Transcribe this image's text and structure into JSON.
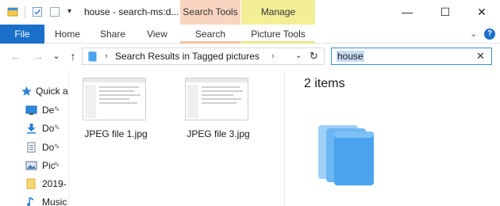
{
  "window": {
    "title": "house - search-ms:d...",
    "qat_dropdown_glyph": "▾",
    "controls": {
      "minimize": "—",
      "maximize": "☐",
      "close": "✕"
    }
  },
  "context_headers": {
    "search_tools": "Search Tools",
    "manage": "Manage"
  },
  "ribbon": {
    "tabs": [
      "File",
      "Home",
      "Share",
      "View",
      "Search",
      "Picture Tools"
    ],
    "collapse_glyph": "⌄",
    "help_glyph": "?"
  },
  "address": {
    "path_text": "Search Results in Tagged pictures",
    "crumb_sep": "›",
    "dropdown_glyph": "⌄",
    "refresh_glyph": "↻",
    "nav": {
      "back": "←",
      "forward": "→",
      "recent": "⌄",
      "up": "↑"
    }
  },
  "search": {
    "value": "house",
    "clear_glyph": "✕"
  },
  "nav_pane": {
    "items": [
      {
        "label": "Quick a",
        "icon": "star-icon",
        "pinned": false
      },
      {
        "label": "De",
        "icon": "desktop-icon",
        "pinned": true
      },
      {
        "label": "Do",
        "icon": "downloads-icon",
        "pinned": true
      },
      {
        "label": "Do",
        "icon": "documents-icon",
        "pinned": true
      },
      {
        "label": "Pic",
        "icon": "pictures-icon",
        "pinned": true
      },
      {
        "label": "2019-",
        "icon": "folder-icon",
        "pinned": false
      },
      {
        "label": "Music",
        "icon": "music-icon",
        "pinned": false
      }
    ],
    "pin_glyph": "📌"
  },
  "files": [
    {
      "name": "JPEG file 1.jpg"
    },
    {
      "name": "JPEG file 3.jpg"
    }
  ],
  "preview": {
    "item_count": "2 items"
  },
  "colors": {
    "file_tab": "#1a6fc9",
    "search_tools_bg": "#f9d4c0",
    "manage_bg": "#f2ef96",
    "search_focus_border": "#3c8ed9",
    "selection_highlight": "#c6dcf2",
    "stack_blue": "#4aa3ec"
  }
}
